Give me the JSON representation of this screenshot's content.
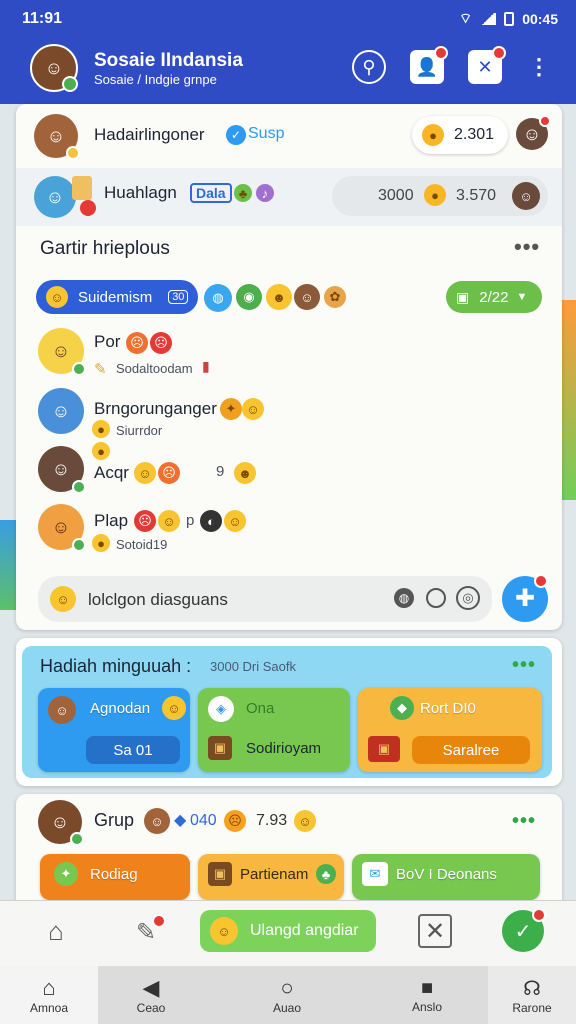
{
  "status": {
    "time": "11:91",
    "time_right": "00:45"
  },
  "header": {
    "title": "Sosaie IIndansia",
    "subtitle": "Sosaie / Indgie grnpe"
  },
  "top_rows": [
    {
      "name": "Hadairlingoner",
      "tag": "Susp",
      "value": "2.301"
    },
    {
      "name": "Huahlagn",
      "tag": "Dala",
      "value_a": "3000",
      "value_b": "3.570"
    }
  ],
  "group_panel": {
    "title": "Gartir hrieplous",
    "filter_label": "Suidemism",
    "filter_count": "30",
    "score_label": "2/22",
    "members": [
      {
        "name": "Por",
        "sub": "Sodaltoodam"
      },
      {
        "name": "Brngorunganger",
        "sub": "Siurrdor"
      },
      {
        "name": "Acqr",
        "sub": "",
        "value": "9"
      },
      {
        "name": "Plap",
        "sub": "Sotoid19",
        "value": "p"
      }
    ],
    "input_placeholder": "lolclgon diasguans"
  },
  "gift_panel": {
    "title": "Hadiah minguuah :",
    "meta": "3000 Dri Saofk",
    "tiles": [
      {
        "label": "Agnodan",
        "button": "Sa 01"
      },
      {
        "label": "Ona",
        "button": "Sodirioyam"
      },
      {
        "label": "Rort DI0",
        "button": "Saralree"
      }
    ]
  },
  "group_card": {
    "title": "Grup",
    "value_a": "040",
    "value_b": "7.93",
    "tiles": [
      "Rodiag",
      "Partienam",
      "BoV I Deonans"
    ]
  },
  "bottom_bar": {
    "center_label": "Ulangd angdiar"
  },
  "nav": [
    "Amnoa",
    "Ceao",
    "Auao",
    "Anslo",
    "Rarone"
  ],
  "colors": {
    "primary": "#2f4cc4",
    "accent_blue": "#3aa6f0",
    "accent_green": "#6cc04a",
    "accent_orange": "#f39a1c",
    "badge_red": "#e53935"
  }
}
